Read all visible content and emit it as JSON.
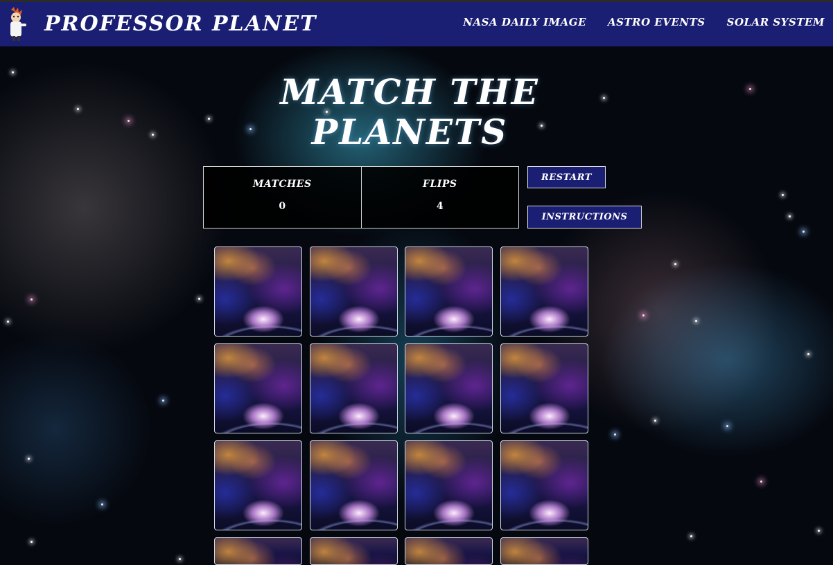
{
  "header": {
    "brand": "PROFESSOR PLANET",
    "nav": [
      "NASA DAILY IMAGE",
      "ASTRO EVENTS",
      "SOLAR SYSTEM"
    ]
  },
  "game": {
    "title_line1": "MATCH THE",
    "title_line2": "PLANETS",
    "matches_label": "MATCHES",
    "matches_value": "0",
    "flips_label": "FLIPS",
    "flips_value": "4",
    "restart_label": "RESTART",
    "instructions_label": "INSTRUCTIONS"
  },
  "colors": {
    "header_bg": "#1b1f73",
    "button_bg": "#1b1f73",
    "text": "#ffffff"
  }
}
